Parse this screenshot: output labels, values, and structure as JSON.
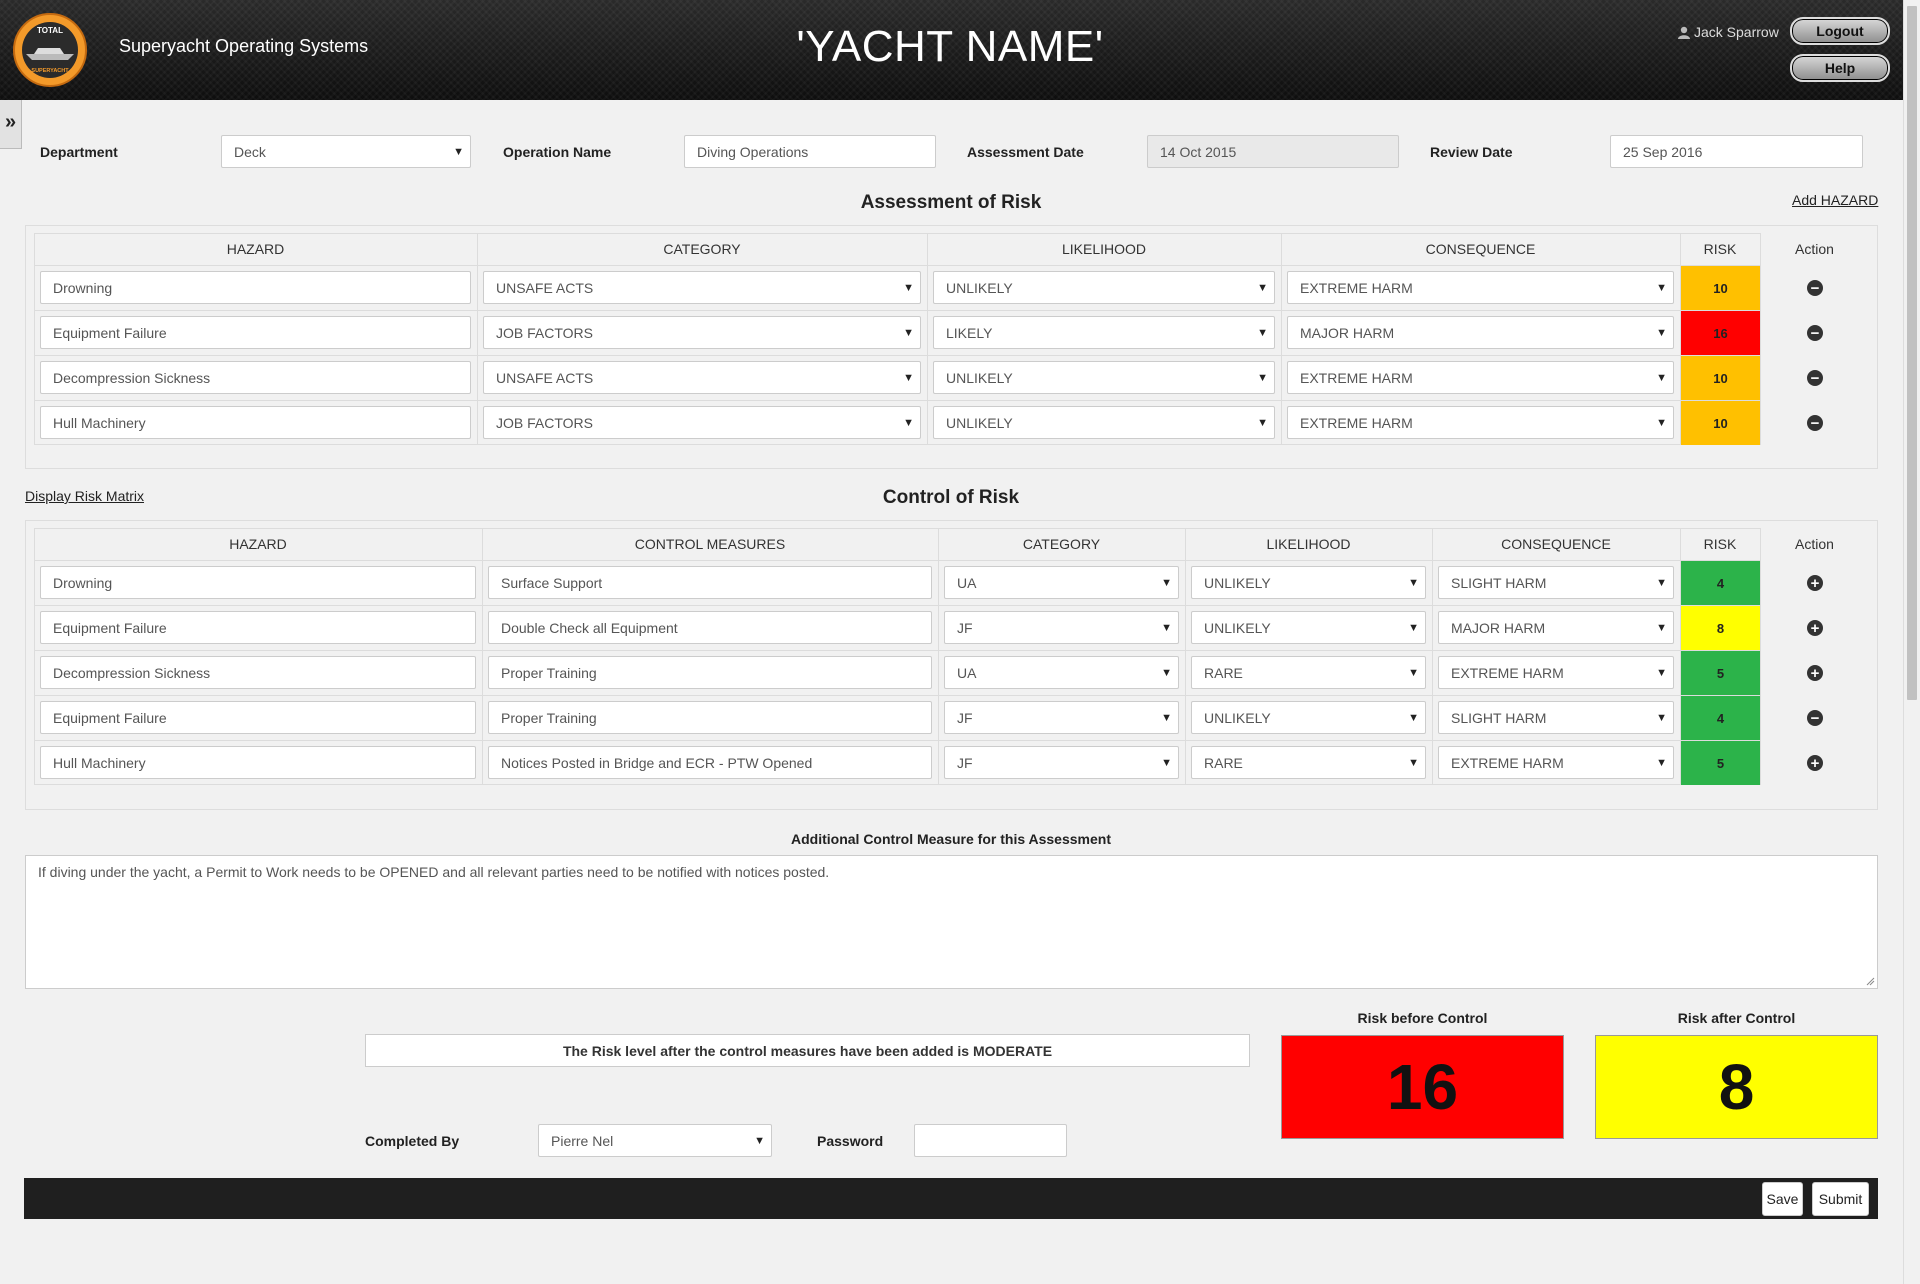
{
  "header": {
    "logo_text": "TOTAL SUPERYACHT",
    "brand": "Superyacht Operating Systems",
    "yacht_name": "'YACHT NAME'",
    "user": "Jack Sparrow",
    "logout": "Logout",
    "help": "Help"
  },
  "form": {
    "department_label": "Department",
    "department_value": "Deck",
    "operation_label": "Operation Name",
    "operation_value": "Diving Operations",
    "assessment_date_label": "Assessment Date",
    "assessment_date_value": "14 Oct 2015",
    "review_date_label": "Review Date",
    "review_date_value": "25 Sep 2016"
  },
  "assessment": {
    "title": "Assessment of Risk",
    "add_link": "Add HAZARD",
    "headers": [
      "HAZARD",
      "CATEGORY",
      "LIKELIHOOD",
      "CONSEQUENCE",
      "RISK",
      "Action"
    ],
    "rows": [
      {
        "hazard": "Drowning",
        "category": "UNSAFE ACTS",
        "likelihood": "UNLIKELY",
        "consequence": "EXTREME HARM",
        "risk": "10",
        "risk_color": "#ffc000",
        "action": "remove"
      },
      {
        "hazard": "Equipment Failure",
        "category": "JOB FACTORS",
        "likelihood": "LIKELY",
        "consequence": "MAJOR HARM",
        "risk": "16",
        "risk_color": "#ff0000",
        "action": "remove"
      },
      {
        "hazard": "Decompression Sickness",
        "category": "UNSAFE ACTS",
        "likelihood": "UNLIKELY",
        "consequence": "EXTREME HARM",
        "risk": "10",
        "risk_color": "#ffc000",
        "action": "remove"
      },
      {
        "hazard": "Hull Machinery",
        "category": "JOB FACTORS",
        "likelihood": "UNLIKELY",
        "consequence": "EXTREME HARM",
        "risk": "10",
        "risk_color": "#ffc000",
        "action": "remove"
      }
    ]
  },
  "control": {
    "title": "Control of Risk",
    "matrix_link": "Display Risk Matrix",
    "headers": [
      "HAZARD",
      "CONTROL MEASURES",
      "CATEGORY",
      "LIKELIHOOD",
      "CONSEQUENCE",
      "RISK",
      "Action"
    ],
    "rows": [
      {
        "hazard": "Drowning",
        "measure": "Surface Support",
        "category": "UA",
        "likelihood": "UNLIKELY",
        "consequence": "SLIGHT HARM",
        "risk": "4",
        "risk_color": "#2cb34a",
        "action": "add"
      },
      {
        "hazard": "Equipment Failure",
        "measure": "Double Check all Equipment",
        "category": "JF",
        "likelihood": "UNLIKELY",
        "consequence": "MAJOR HARM",
        "risk": "8",
        "risk_color": "#ffff00",
        "action": "add"
      },
      {
        "hazard": "Decompression Sickness",
        "measure": "Proper Training",
        "category": "UA",
        "likelihood": "RARE",
        "consequence": "EXTREME HARM",
        "risk": "5",
        "risk_color": "#2cb34a",
        "action": "add"
      },
      {
        "hazard": "Equipment Failure",
        "measure": "Proper Training",
        "category": "JF",
        "likelihood": "UNLIKELY",
        "consequence": "SLIGHT HARM",
        "risk": "4",
        "risk_color": "#2cb34a",
        "action": "remove"
      },
      {
        "hazard": "Hull Machinery",
        "measure": "Notices Posted in Bridge and ECR - PTW Opened",
        "category": "JF",
        "likelihood": "RARE",
        "consequence": "EXTREME HARM",
        "risk": "5",
        "risk_color": "#2cb34a",
        "action": "add"
      }
    ]
  },
  "additional": {
    "label": "Additional Control Measure for this Assessment",
    "text": "If diving under the yacht, a Permit to Work needs to be OPENED and all relevant parties need to be notified with notices posted."
  },
  "summary": {
    "message": "The Risk level after the control measures have been added is MODERATE",
    "before_label": "Risk before Control",
    "before_value": "16",
    "before_color": "#ff0000",
    "after_label": "Risk after Control",
    "after_value": "8",
    "after_color": "#ffff00"
  },
  "completion": {
    "completed_by_label": "Completed By",
    "completed_by_value": "Pierre Nel",
    "password_label": "Password",
    "password_value": ""
  },
  "footer": {
    "save": "Save",
    "submit": "Submit"
  }
}
